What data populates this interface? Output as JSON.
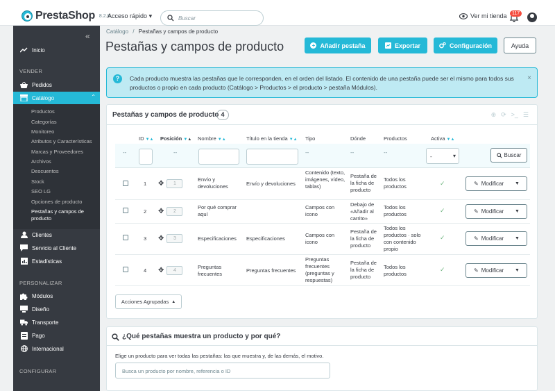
{
  "header": {
    "brand": "PrestaShop",
    "version": "8.2.8",
    "quick_access": "Acceso rápido",
    "search_placeholder": "Buscar",
    "view_shop": "Ver mi tienda",
    "notifications": "117"
  },
  "sidebar": {
    "home": "Inicio",
    "section_sell": "VENDER",
    "orders": "Pedidos",
    "catalog": "Catálogo",
    "catalog_sub": [
      "Productos",
      "Categorías",
      "Monitoreo",
      "Atributos y Características",
      "Marcas y Proveedores",
      "Archivos",
      "Descuentos",
      "Stock",
      "SEO LG",
      "Opciones de producto",
      "Pestañas y campos de producto"
    ],
    "clients": "Clientes",
    "service": "Servicio al Cliente",
    "stats": "Estadísticas",
    "section_customize": "PERSONALIZAR",
    "modules": "Módulos",
    "design": "Diseño",
    "shipping": "Transporte",
    "payment": "Pago",
    "international": "Internacional",
    "section_configure": "CONFIGURAR"
  },
  "page": {
    "breadcrumb_parent": "Catálogo",
    "breadcrumb_sep": "/",
    "breadcrumb_current": "Pestañas y campos de producto",
    "title": "Pestañas y campos de producto",
    "btn_add": "Añadir pestaña",
    "btn_export": "Exportar",
    "btn_config": "Configuración",
    "btn_help": "Ayuda"
  },
  "info": {
    "text": "Cada producto muestra las pestañas que le corresponden, en el orden del listado. El contenido de una pestaña puede ser el mismo para todos sus productos o propio en cada producto (Catálogo > Productos > el producto > pestaña Módulos)."
  },
  "table": {
    "title": "Pestañas y campos de producto",
    "count": "4",
    "headers": {
      "id": "ID",
      "position": "Posición",
      "name": "Nombre",
      "shop_title": "Título en la tienda",
      "type": "Tipo",
      "where": "Dónde",
      "products": "Productos",
      "active": "Activa"
    },
    "filter_dash": "--",
    "filter_select": "-",
    "filter_search": "Buscar",
    "edit_label": "Modificar",
    "bulk_actions": "Acciones Agrupadas",
    "rows": [
      {
        "id": "1",
        "position": "1",
        "name": "Envío y devoluciones",
        "shop_title": "Envío y devoluciones",
        "type": "Contenido (texto, imágenes, vídeo, tablas)",
        "where": "Pestaña de la ficha de producto",
        "products": "Todos los productos"
      },
      {
        "id": "2",
        "position": "2",
        "name": "Por qué comprar aquí",
        "shop_title": "",
        "type": "Campos con icono",
        "where": "Debajo de «Añadir al carrito»",
        "products": "Todos los productos"
      },
      {
        "id": "3",
        "position": "3",
        "name": "Especificaciones",
        "shop_title": "Especificaciones",
        "type": "Campos con icono",
        "where": "Pestaña de la ficha de producto",
        "products": "Todos los productos · solo con contenido propio"
      },
      {
        "id": "4",
        "position": "4",
        "name": "Preguntas frecuentes",
        "shop_title": "Preguntas frecuentes",
        "type": "Preguntas frecuentes (preguntas y respuestas)",
        "where": "Pestaña de la ficha de producto",
        "products": "Todos los productos"
      }
    ]
  },
  "which_tabs": {
    "title": "¿Qué pestañas muestra un producto y por qué?",
    "description": "Elige un producto para ver todas las pestañas: las que muestra y, de las demás, el motivo.",
    "placeholder": "Busca un producto por nombre, referencia o ID"
  },
  "colors": {
    "accent": "#25b9d7",
    "sidebar": "#363a41",
    "success": "#70b580"
  }
}
